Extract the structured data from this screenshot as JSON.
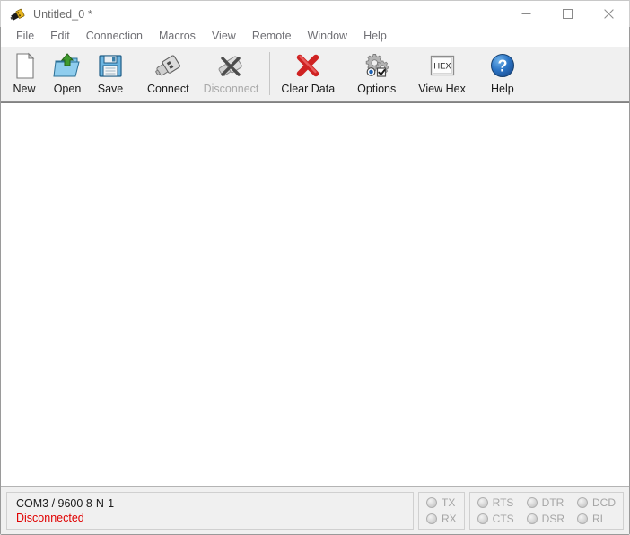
{
  "window": {
    "title": "Untitled_0 *",
    "app_icon": "serial-plug-icon",
    "controls": {
      "minimize": "minimize-button",
      "maximize": "maximize-button",
      "close": "close-button"
    }
  },
  "menubar": {
    "items": [
      {
        "label": "File"
      },
      {
        "label": "Edit"
      },
      {
        "label": "Connection"
      },
      {
        "label": "Macros"
      },
      {
        "label": "View"
      },
      {
        "label": "Remote"
      },
      {
        "label": "Window"
      },
      {
        "label": "Help"
      }
    ]
  },
  "toolbar": {
    "buttons": [
      {
        "label": "New",
        "icon": "new-document-icon",
        "enabled": true
      },
      {
        "label": "Open",
        "icon": "open-folder-icon",
        "enabled": true
      },
      {
        "label": "Save",
        "icon": "floppy-disk-icon",
        "enabled": true
      },
      {
        "label": "Connect",
        "icon": "usb-plug-icon",
        "enabled": true
      },
      {
        "label": "Disconnect",
        "icon": "usb-plug-disconnect-icon",
        "enabled": false
      },
      {
        "label": "Clear Data",
        "icon": "red-x-icon",
        "enabled": true
      },
      {
        "label": "Options",
        "icon": "gears-options-icon",
        "enabled": true
      },
      {
        "label": "View Hex",
        "icon": "hex-button-icon",
        "enabled": true
      },
      {
        "label": "Help",
        "icon": "blue-question-icon",
        "enabled": true
      }
    ],
    "hex_icon_text": "HEX"
  },
  "terminal": {
    "content": "",
    "placeholder": ""
  },
  "statusbar": {
    "connection": "COM3 / 9600 8-N-1",
    "status": "Disconnected",
    "status_color": "#e00000",
    "led_groups": [
      {
        "name": "data-leds",
        "leds": [
          {
            "label": "TX",
            "on": false
          },
          {
            "label": "RX",
            "on": false
          }
        ]
      },
      {
        "name": "modem-leds",
        "leds": [
          {
            "label": "RTS",
            "on": false
          },
          {
            "label": "CTS",
            "on": false
          },
          {
            "label": "DTR",
            "on": false
          },
          {
            "label": "DSR",
            "on": false
          },
          {
            "label": "DCD",
            "on": false
          },
          {
            "label": "RI",
            "on": false
          }
        ]
      }
    ]
  }
}
